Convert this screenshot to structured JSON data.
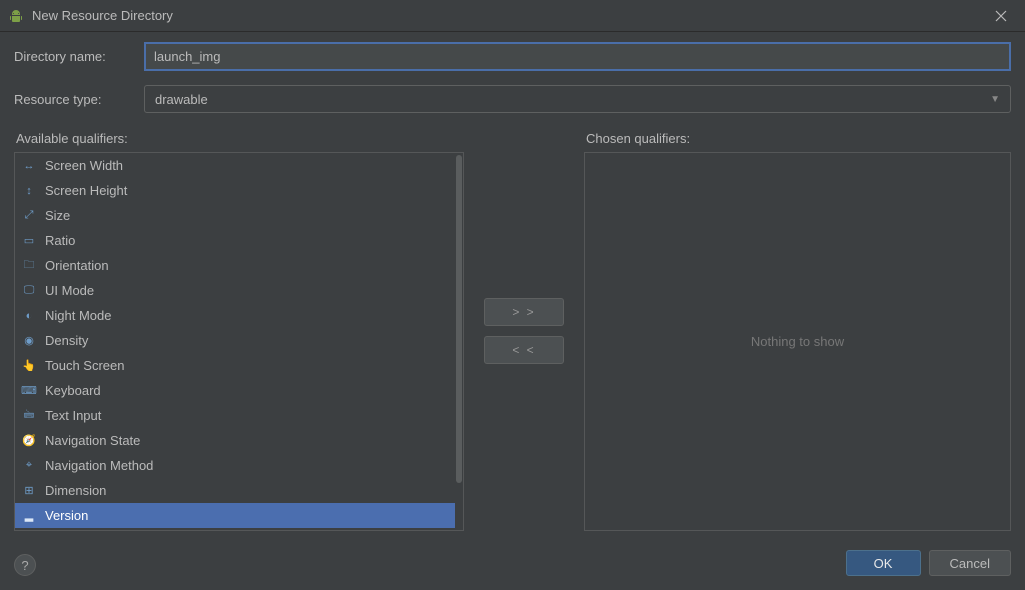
{
  "window": {
    "title": "New Resource Directory"
  },
  "form": {
    "directory_name_label": "Directory name:",
    "directory_name_value": "launch_img",
    "resource_type_label": "Resource type:",
    "resource_type_value": "drawable"
  },
  "qualifiers": {
    "available_label": "Available qualifiers:",
    "chosen_label": "Chosen qualifiers:",
    "add_label": "> >",
    "remove_label": "< <",
    "empty_chosen": "Nothing to show",
    "available": [
      {
        "label": "Screen Width",
        "icon": "↔"
      },
      {
        "label": "Screen Height",
        "icon": "↕"
      },
      {
        "label": "Size",
        "icon": "⤢"
      },
      {
        "label": "Ratio",
        "icon": "▭"
      },
      {
        "label": "Orientation",
        "icon": "🗀"
      },
      {
        "label": "UI Mode",
        "icon": "🖵"
      },
      {
        "label": "Night Mode",
        "icon": "◐"
      },
      {
        "label": "Density",
        "icon": "◉"
      },
      {
        "label": "Touch Screen",
        "icon": "👆"
      },
      {
        "label": "Keyboard",
        "icon": "⌨"
      },
      {
        "label": "Text Input",
        "icon": "🖮"
      },
      {
        "label": "Navigation State",
        "icon": "🧭"
      },
      {
        "label": "Navigation Method",
        "icon": "⌖"
      },
      {
        "label": "Dimension",
        "icon": "⊞"
      },
      {
        "label": "Version",
        "icon": "▂",
        "selected": true
      }
    ]
  },
  "footer": {
    "ok": "OK",
    "cancel": "Cancel",
    "help": "?"
  }
}
